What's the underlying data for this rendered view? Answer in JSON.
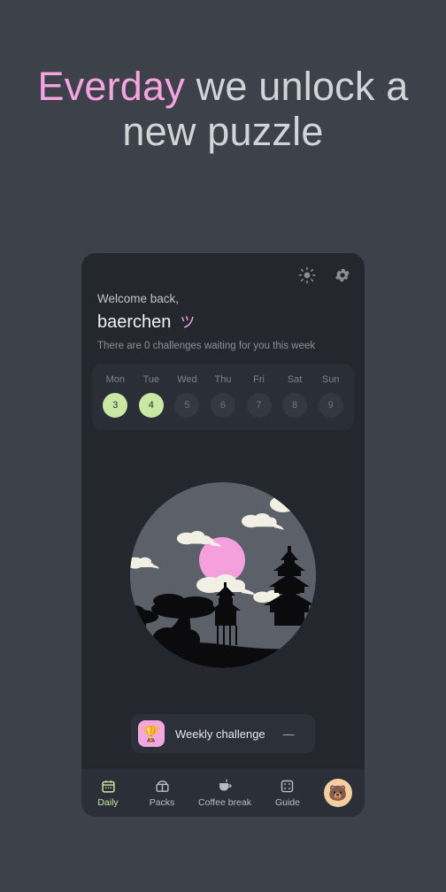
{
  "headline": {
    "accent_word": "Everday",
    "rest": " we unlock a new puzzle",
    "accent_color": "#f6a3e0"
  },
  "card": {
    "topbar": {
      "brightness_icon": "sun-icon",
      "settings_icon": "gear-icon"
    },
    "greeting": {
      "welcome": "Welcome back,",
      "username": "baerchen",
      "smiley": "ツ",
      "note": "There are 0 challenges waiting for you this week"
    },
    "week": {
      "days": [
        {
          "name": "Mon",
          "num": "3",
          "done": true
        },
        {
          "name": "Tue",
          "num": "4",
          "done": true
        },
        {
          "name": "Wed",
          "num": "5",
          "done": false
        },
        {
          "name": "Thu",
          "num": "6",
          "done": false
        },
        {
          "name": "Fri",
          "num": "7",
          "done": false
        },
        {
          "name": "Sat",
          "num": "8",
          "done": false
        },
        {
          "name": "Sun",
          "num": "9",
          "done": false
        }
      ],
      "done_color": "#c8e8a4",
      "pending_color": "#343840"
    },
    "illustration": {
      "name": "night-pagoda-scene",
      "sky_color": "#5b6069",
      "moon_color": "#f5a0dc",
      "cloud_color": "#f2f0e4",
      "silhouette_color": "#0b0b0d"
    },
    "weekly_challenge": {
      "icon": "trophy-icon",
      "emoji": "🏆",
      "label": "Weekly challenge",
      "dash": "—",
      "tile_color": "#f3a6e0"
    },
    "nav": {
      "items": [
        {
          "label": "Daily",
          "icon": "calendar-icon",
          "active": true
        },
        {
          "label": "Packs",
          "icon": "pack-icon",
          "active": false
        },
        {
          "label": "Coffee break",
          "icon": "coffee-cup-icon",
          "active": false
        },
        {
          "label": "Guide",
          "icon": "dice-icon",
          "active": false
        }
      ],
      "avatar": {
        "icon": "bear-avatar",
        "emoji": "🐻",
        "bg": "#f5cf9f"
      },
      "active_color": "#c8e8a4"
    }
  }
}
